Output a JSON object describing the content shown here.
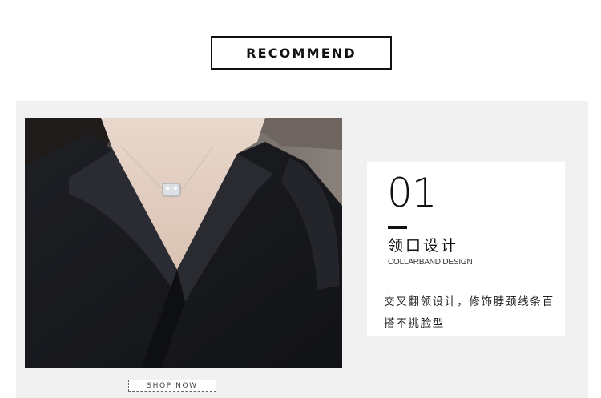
{
  "header": {
    "title": "RECOMMEND"
  },
  "feature": {
    "number": "01",
    "title_cn": "领口设计",
    "title_en": "COLLARBAND DESIGN",
    "description": "交叉翻领设计，修饰脖颈线条百搭不挑脸型"
  },
  "shop_button": {
    "label": "SHOP NOW"
  },
  "colors": {
    "accent": "#111111",
    "panel_bg": "#f1f1f1",
    "dress": "#1c1d22"
  },
  "photo": {
    "subject": "black-v-neck-dress-collar"
  }
}
